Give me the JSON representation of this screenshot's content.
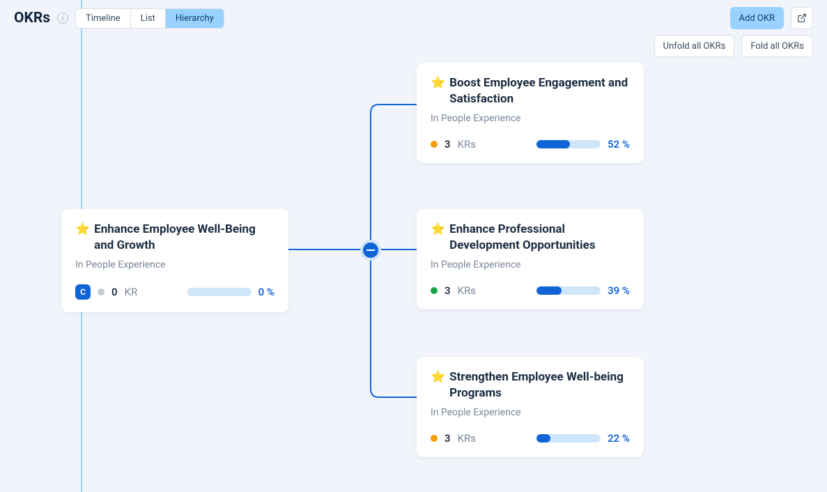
{
  "header": {
    "title": "OKRs",
    "tabs": {
      "timeline": "Timeline",
      "list": "List",
      "hierarchy": "Hierarchy"
    },
    "active_tab": "hierarchy",
    "add_button": "Add OKR"
  },
  "actions": {
    "unfold": "Unfold all OKRs",
    "fold": "Fold all OKRs"
  },
  "root_okr": {
    "emoji": "⭐",
    "title": "Enhance Employee Well-Being and Growth",
    "team": "In People Experience",
    "owner_initial": "C",
    "status_color": "#c6ccd5",
    "kr_count": "0",
    "kr_label": "KR",
    "progress_pct": 0,
    "progress_text": "0 %"
  },
  "children": [
    {
      "emoji": "⭐",
      "title": "Boost Employee Engagement and Satisfaction",
      "team": "In People Experience",
      "status_color": "#f59e0b",
      "kr_count": "3",
      "kr_label": "KRs",
      "progress_pct": 52,
      "progress_text": "52 %"
    },
    {
      "emoji": "⭐",
      "title": "Enhance Professional Development Opportunities",
      "team": "In People Experience",
      "status_color": "#16a34a",
      "kr_count": "3",
      "kr_label": "KRs",
      "progress_pct": 39,
      "progress_text": "39 %"
    },
    {
      "emoji": "⭐",
      "title": "Strengthen Employee Well-being Programs",
      "team": "In People Experience",
      "status_color": "#f59e0b",
      "kr_count": "3",
      "kr_label": "KRs",
      "progress_pct": 22,
      "progress_text": "22 %"
    }
  ]
}
